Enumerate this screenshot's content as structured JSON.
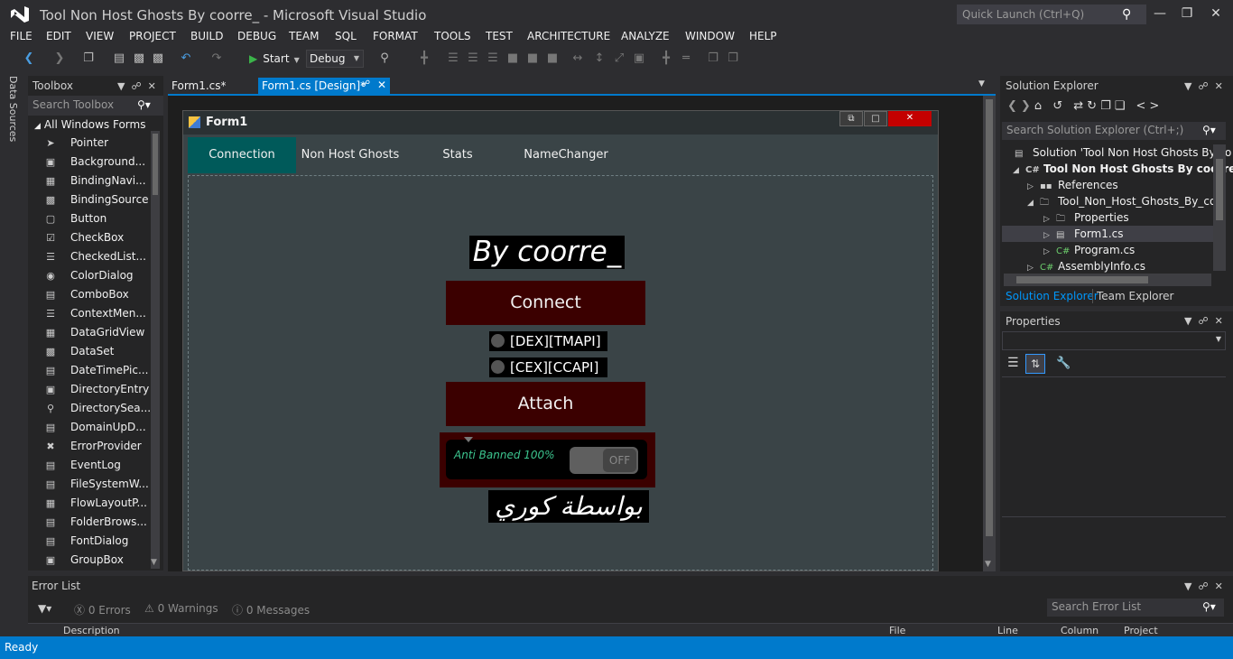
{
  "window": {
    "title": "Tool Non Host Ghosts By coorre_ - Microsoft Visual Studio",
    "quick_launch_placeholder": "Quick Launch (Ctrl+Q)"
  },
  "menu": [
    "FILE",
    "EDIT",
    "VIEW",
    "PROJECT",
    "BUILD",
    "DEBUG",
    "TEAM",
    "SQL",
    "FORMAT",
    "TOOLS",
    "TEST",
    "ARCHITECTURE",
    "ANALYZE",
    "WINDOW",
    "HELP"
  ],
  "toolbar": {
    "start_label": "Start",
    "configuration": "Debug"
  },
  "side_tab": "Data Sources",
  "toolbox": {
    "title": "Toolbox",
    "search_placeholder": "Search Toolbox",
    "group": "All Windows Forms",
    "items": [
      "Pointer",
      "Background...",
      "BindingNavi...",
      "BindingSource",
      "Button",
      "CheckBox",
      "CheckedList...",
      "ColorDialog",
      "ComboBox",
      "ContextMen...",
      "DataGridView",
      "DataSet",
      "DateTimePic...",
      "DirectoryEntry",
      "DirectorySea...",
      "DomainUpD...",
      "ErrorProvider",
      "EventLog",
      "FileSystemW...",
      "FlowLayoutP...",
      "FolderBrows...",
      "FontDialog",
      "GroupBox"
    ]
  },
  "doc_tabs": {
    "form1cs": "Form1.cs*",
    "design": "Form1.cs [Design]*"
  },
  "form": {
    "title": "Form1",
    "tabs": [
      "Connection",
      "Non Host Ghosts",
      "Stats",
      "NameChanger"
    ],
    "by_label": "By coorre_",
    "connect_label": "Connect",
    "radio_dex": "[DEX][TMAPI]",
    "radio_cex": "[CEX][CCAPI]",
    "attach_label": "Attach",
    "anti_label": "Anti Banned 100%",
    "switch_label": "OFF",
    "arabic_label": "بواسطة كوري"
  },
  "solution_explorer": {
    "title": "Solution Explorer",
    "search_placeholder": "Search Solution Explorer (Ctrl+;)",
    "nodes": [
      "Solution 'Tool Non Host Ghosts By co",
      "Tool Non Host Ghosts By coorre_",
      "References",
      "Tool_Non_Host_Ghosts_By_coo",
      "Properties",
      "Form1.cs",
      "Program.cs",
      "AssemblyInfo.cs"
    ],
    "tab_se": "Solution Explorer",
    "tab_te": "Team Explorer"
  },
  "properties": {
    "title": "Properties"
  },
  "error_list": {
    "title": "Error List",
    "errors": "0 Errors",
    "warnings": "0 Warnings",
    "messages": "0 Messages",
    "search_placeholder": "Search Error List",
    "columns": [
      "Description",
      "File",
      "Line",
      "Column",
      "Project"
    ]
  },
  "status": "Ready",
  "colors": {
    "accent": "#007acc",
    "button_dark_red": "#3b0000",
    "close_red": "#c40000",
    "selected_tab": "#005a5a",
    "anti_text": "#3cc58f"
  }
}
